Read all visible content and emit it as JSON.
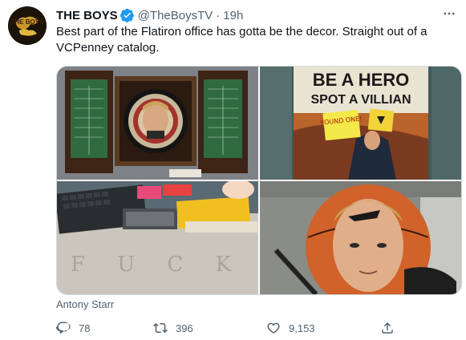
{
  "account": {
    "name": "THE BOYS",
    "handle": "@TheBoysTV",
    "separator": "·",
    "time": "19h",
    "verified": true,
    "avatar_text": "THE BOYS"
  },
  "tweet": {
    "text": "Best part of the Flatiron office has gotta be the decor. Straight out of a VCPenney catalog."
  },
  "media": {
    "poster_line1": "BE A HERO",
    "poster_line2": "SPOT A VILLIAN",
    "sticky_note": "FOUND ONE!",
    "desk_writing": "F U C K",
    "icons": [
      "dartboard-cabinet-photo",
      "poster-photo",
      "desk-photo",
      "basketball-mask-photo"
    ]
  },
  "caption": "Antony Starr",
  "actions": {
    "reply_count": "78",
    "retweet_count": "396",
    "like_count": "9,153"
  },
  "colors": {
    "text_primary": "#0f1419",
    "text_secondary": "#536471",
    "verified": "#1d9bf0",
    "border": "#cfd9de"
  }
}
